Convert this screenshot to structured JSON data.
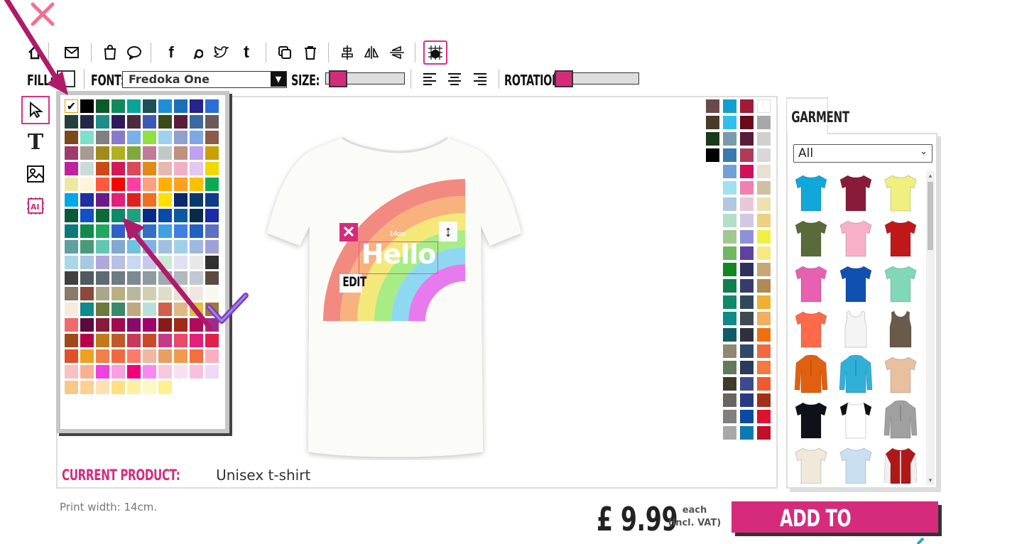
{
  "toolbar": {
    "icons": [
      "home-icon",
      "mail-icon",
      "shop-icon",
      "chat-icon",
      "facebook-icon",
      "pinterest-icon",
      "twitter-icon",
      "tumblr-icon",
      "copy-icon",
      "trash-icon",
      "align-center-icon",
      "flip-horizontal-icon",
      "flip-vertical-icon",
      "snap-grid-icon"
    ],
    "facebook": "f",
    "tumblr": "t"
  },
  "options": {
    "fill_label": "FILL:",
    "font_label": "FONT:",
    "font_value": "Fredoka One",
    "size_label": "SIZE:",
    "rotation_label": "ROTATION:",
    "size_slider": 0.05,
    "rotation_slider": 0.0
  },
  "tools": {
    "text_glyph": "T"
  },
  "palette": {
    "colors": [
      "#ffffff",
      "#000000",
      "#0b5a2a",
      "#0e8a5e",
      "#0aa39a",
      "#1e4e5a",
      "#1d8fd6",
      "#1b6fb8",
      "#24248a",
      "#2a6fd6",
      "#24403a",
      "#26264a",
      "#1e8a8a",
      "#2f1b5c",
      "#4a2a40",
      "#3b5ab8",
      "#3a4a1a",
      "#5a1d3a",
      "#3a6aa0",
      "#6a5a5a",
      "#7a4a1a",
      "#7de0c8",
      "#808080",
      "#8a7acc",
      "#7ab0e8",
      "#90e040",
      "#9ed0f0",
      "#90a0d0",
      "#80a8e0",
      "#8a5a4a",
      "#a03a6a",
      "#a89a90",
      "#a08a1a",
      "#b0b020",
      "#80a840",
      "#c07a9a",
      "#c0c8c8",
      "#c09080",
      "#c0a0f0",
      "#c8a000",
      "#c020a0",
      "#c8dcdc",
      "#cc4a1a",
      "#d01a5a",
      "#d84a5a",
      "#e08a1a",
      "#e8b8b0",
      "#f0b0c8",
      "#e0c8f0",
      "#f0d800",
      "#f0e8a0",
      "#fff4d8",
      "#ff5a3a",
      "#ff0000",
      "#ff40a0",
      "#ffa080",
      "#ffb000",
      "#ffa020",
      "#ffc000",
      "#10a850",
      "#00a8e8",
      "#2030a0",
      "#6a1a8a",
      "#e0207a",
      "#e02020",
      "#f07020",
      "#ffe000",
      "#0a2a6a",
      "#0a3a6a",
      "#103a8a",
      "#0a5a3a",
      "#1050c8",
      "#0a6a3a",
      "#0e8a6a",
      "#20a080",
      "#0a2a8a",
      "#0a4aa8",
      "#0a5aa0",
      "#0a2a4a",
      "#1a2aa8",
      "#0a7a7a",
      "#108a48",
      "#20a860",
      "#3060c8",
      "#10a8c0",
      "#3070c0",
      "#40a0e0",
      "#4080e0",
      "#2060c0",
      "#6070c0",
      "#60a0a0",
      "#4a9a7a",
      "#60c8b0",
      "#80a8d0",
      "#70c0e0",
      "#80b0e8",
      "#a0c0e0",
      "#a0d0e8",
      "#a0b8e0",
      "#a0a0d8",
      "#a8d8e8",
      "#a8c8e0",
      "#b0a8d8",
      "#b8c0e0",
      "#c8d8f0",
      "#c8c8e8",
      "#c8e8d8",
      "#e0e0f0",
      "#e8e8e8",
      "#303030",
      "#404040",
      "#505a60",
      "#606a70",
      "#707a80",
      "#808890",
      "#909aa0",
      "#a0a8b0",
      "#b0b8c0",
      "#c0c8d0",
      "#5a4a40",
      "#8a7a6a",
      "#8a4a3a",
      "#a8a888",
      "#b8b080",
      "#b8b8a0",
      "#d0d0b0",
      "#e0dcc8",
      "#e8e0d0",
      "#f0e8e0",
      "#f8f8f0",
      "#f8ead8",
      "#108a8a",
      "#6a7a3a",
      "#3a8a6a",
      "#c0a880",
      "#b8e0d8",
      "#d0604a",
      "#e0b888",
      "#e0c040",
      "#a07a30",
      "#f06a6a",
      "#5a0a40",
      "#8a1a3a",
      "#a00a50",
      "#8a0a6a",
      "#a0006a",
      "#8a1a1a",
      "#a02a1a",
      "#b00a5a",
      "#a02a8a",
      "#a04a1a",
      "#b8004a",
      "#c07a1a",
      "#c05a2a",
      "#c83a5a",
      "#c84a2a",
      "#c8388a",
      "#e84a6a",
      "#e0207a",
      "#e0204a",
      "#e0502a",
      "#f0a020",
      "#f0804a",
      "#f06a40",
      "#ff7a6a",
      "#f0b8a0",
      "#e8a060",
      "#f09a50",
      "#f07040",
      "#f8b0c0",
      "#f8c0c0",
      "#f8b090",
      "#f040e0",
      "#f8a0e0",
      "#f0007a",
      "#f888f0",
      "#f8c8e0",
      "#f8e0f0",
      "#f8c0e0",
      "#f0d8f8",
      "#f8c888",
      "#ffd090",
      "#ffe0b0",
      "#ffe080",
      "#fff0a0",
      "#fff8c0",
      "#fff090"
    ],
    "selected_index": 0,
    "check": "✔"
  },
  "garment_colors": [
    "#6a4a4a",
    "#10a0d0",
    "#a01a3a",
    "#ffffff",
    "#4a3a2a",
    "#30c0f0",
    "#6a0a1a",
    "#a8a8a8",
    "#1a3a1a",
    "#7a9ab0",
    "#5a1a3a",
    "#d0d0d0",
    "#000000",
    "#3a7ab0",
    "#b03a5a",
    "#d8d8d8",
    null,
    "#70a0d8",
    "#d0105a",
    "#e8e0d0",
    null,
    "#a0e0f0",
    "#f080b0",
    "#d0c0a0",
    null,
    "#b0c8e0",
    "#e8c8d8",
    "#f0e0b0",
    null,
    "#b0e0c8",
    "#d0c8e0",
    "#f0d080",
    null,
    "#a0c890",
    "#9090d8",
    "#f0f040",
    null,
    "#70b860",
    "#6040a0",
    "#f8e880",
    null,
    "#108a20",
    "#30305a",
    "#c8a870",
    null,
    "#108050",
    "#3a3a6a",
    "#b08a50",
    null,
    "#108a6a",
    "#304a5a",
    "#f0b030",
    null,
    "#108a8a",
    "#404a50",
    "#f0b060",
    null,
    "#105a6a",
    "#303040",
    "#f07010",
    null,
    "#908870",
    "#304a6a",
    "#f06a40",
    null,
    "#607a5a",
    "#2a3a5a",
    "#f07a40",
    null,
    "#403a2a",
    "#404890",
    "#f05a30",
    null,
    "#6a6460",
    "#2a3a80",
    "#a0301a",
    null,
    "#808080",
    "#0a4aa0",
    "#e01030",
    null,
    "#a8a8a8",
    "#0a7ab0",
    "#c0102a"
  ],
  "garment_colors_mid_rows_offset": 4,
  "design": {
    "text": "Hello",
    "dimension": "14cm",
    "edit_label": "EDIT"
  },
  "current_product": {
    "label": "CURRENT PRODUCT:",
    "value": "Unisex t-shirt"
  },
  "garment_panel": {
    "tab": "GARMENT",
    "filter": "All",
    "items": [
      {
        "name": "tee",
        "color": "#10a8d8"
      },
      {
        "name": "tee",
        "color": "#8a1a3a"
      },
      {
        "name": "tee",
        "color": "#f0f080"
      },
      {
        "name": "tee",
        "color": "#5a6a3a"
      },
      {
        "name": "tee",
        "color": "#f8b0c8"
      },
      {
        "name": "tee",
        "color": "#c01818"
      },
      {
        "name": "tee",
        "color": "#e860b0"
      },
      {
        "name": "tee",
        "color": "#1050b0"
      },
      {
        "name": "tee",
        "color": "#80d8b8"
      },
      {
        "name": "tee",
        "color": "#ff6a4a"
      },
      {
        "name": "tank",
        "color": "#f4f4f4"
      },
      {
        "name": "tank",
        "color": "#6a5a4a"
      },
      {
        "name": "hoodie",
        "color": "#e06010"
      },
      {
        "name": "hoodie",
        "color": "#30b0d8"
      },
      {
        "name": "tee",
        "color": "#e8c0a0"
      },
      {
        "name": "tee",
        "color": "#101018"
      },
      {
        "name": "raglan",
        "color": "#ffffff"
      },
      {
        "name": "hoodie",
        "color": "#a0a0a0"
      },
      {
        "name": "tee",
        "color": "#f0e8d8"
      },
      {
        "name": "tee",
        "color": "#c8e0f0"
      },
      {
        "name": "jacket",
        "color": "#b01818"
      }
    ]
  },
  "footer": {
    "print_width": "Print width: 14cm.",
    "price": "£ 9.99",
    "price_note_1": "each",
    "price_note_2": "(incl. VAT)",
    "add_to_basket": "ADD TO BASKET"
  }
}
